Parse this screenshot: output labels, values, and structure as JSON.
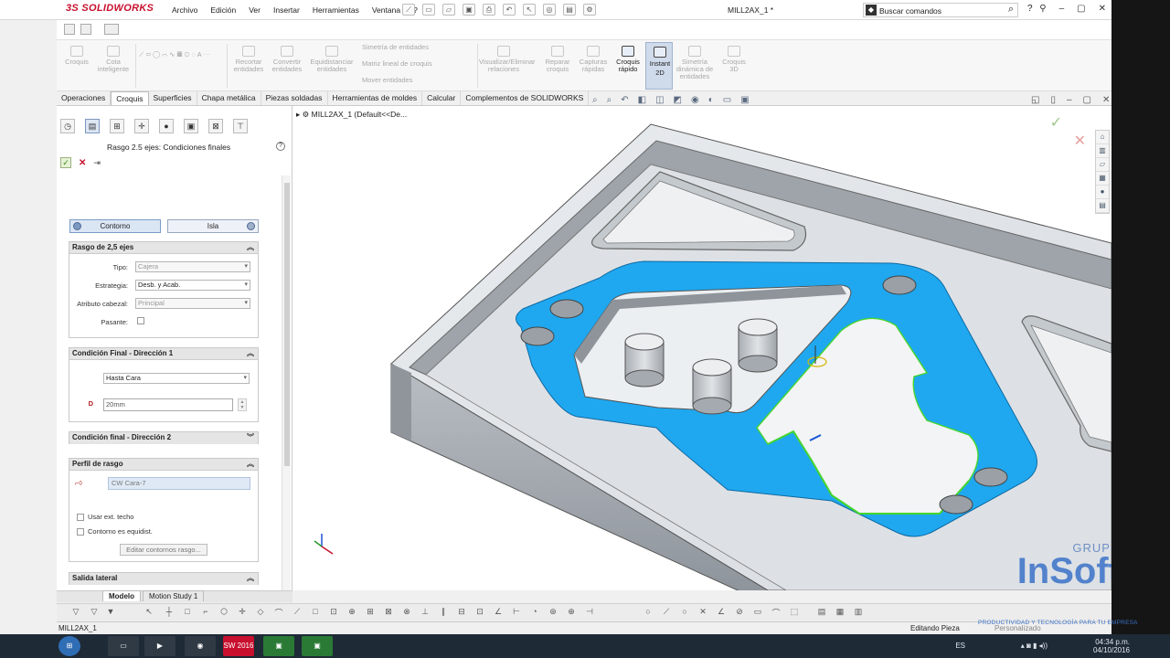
{
  "app": {
    "logo_ds": "3S",
    "logo_name": "SOLIDWORKS",
    "menu": [
      "Archivo",
      "Edición",
      "Ver",
      "Insertar",
      "Herramientas",
      "Ventana",
      "?"
    ],
    "document_title": "MILL2AX_1 *",
    "search_placeholder": "Buscar comandos",
    "help_label": "?"
  },
  "ribbon": {
    "left_group": [
      {
        "label": "Croquis",
        "enabled": false
      },
      {
        "label": "Cota inteligente",
        "enabled": false
      }
    ],
    "mid_group": [
      {
        "label": "Recortar entidades",
        "enabled": false
      },
      {
        "label": "Convertir entidades",
        "enabled": false
      },
      {
        "label": "Equidistanciar entidades",
        "enabled": false
      }
    ],
    "list_group": [
      {
        "label": "Simetría de entidades",
        "enabled": false
      },
      {
        "label": "Matriz lineal de croquis",
        "enabled": false
      },
      {
        "label": "Mover entidades",
        "enabled": false
      }
    ],
    "right_group": [
      {
        "label": "Visualizar/Eliminar relaciones",
        "enabled": false
      },
      {
        "label": "Reparar croquis",
        "enabled": false
      },
      {
        "label": "Capturas rápidas",
        "enabled": false
      },
      {
        "label": "Croquis rápido",
        "enabled": true
      },
      {
        "label": "Instant 2D",
        "enabled": true,
        "selected": true
      },
      {
        "label": "Simetría dinámica de entidades",
        "enabled": false
      },
      {
        "label": "Croquis 3D",
        "enabled": false
      }
    ]
  },
  "command_tabs": [
    "Operaciones",
    "Croquis",
    "Superficies",
    "Chapa metálica",
    "Piezas soldadas",
    "Herramientas de moldes",
    "Calcular",
    "Complementos de SOLIDWORKS"
  ],
  "active_tab": "Croquis",
  "panel": {
    "title": "Rasgo 2.5 ejes: Condiciones finales",
    "help": "?",
    "toggle": {
      "left": "Contorno",
      "right": "Isla"
    },
    "section1": {
      "title": "Rasgo de 2,5 ejes",
      "rows": [
        {
          "label": "Tipo:",
          "value": "Cajera",
          "disabled": true
        },
        {
          "label": "Estrategia:",
          "value": "Desb. y Acab.",
          "disabled": false
        },
        {
          "label": "Atributo cabezal:",
          "value": "Principal",
          "disabled": true
        }
      ],
      "checkbox_label": "Pasante:"
    },
    "section2": {
      "title": "Condición Final - Dirección 1",
      "end_condition": "Hasta Cara",
      "distance": "20mm",
      "depth_label": "D"
    },
    "section3": {
      "title": "Condición final - Dirección 2"
    },
    "section4": {
      "title": "Perfil de rasgo",
      "profile": "CW Cara-7",
      "opt1": "Usar ext. techo",
      "opt2": "Contorno es equidist.",
      "edit_button": "Editar contornos rasgo..."
    },
    "section5": {
      "title": "Salida lateral"
    }
  },
  "viewport": {
    "tree_label": "MILL2AX_1  (Default<<De...",
    "part_colors": {
      "face_selected": "#1fa8f0",
      "body": "#c9cfd6",
      "edge_highlight": "#55e13a"
    }
  },
  "model_tabs": [
    "Modelo",
    "Motion Study 1"
  ],
  "active_model_tab": "Modelo",
  "status": {
    "left": "MILL2AX_1",
    "middle": "Editando Pieza",
    "right": "Personalizado"
  },
  "watermark": {
    "top": "GRUPO",
    "name": "InSoft",
    "tagline": "PRODUCTIVIDAD Y TECNOLOGÍA PARA TU EMPRESA"
  },
  "taskbar": {
    "sw_badge": "SW 2016",
    "lang": "ES",
    "time": "04:34 p.m.",
    "date": "04/10/2016"
  }
}
